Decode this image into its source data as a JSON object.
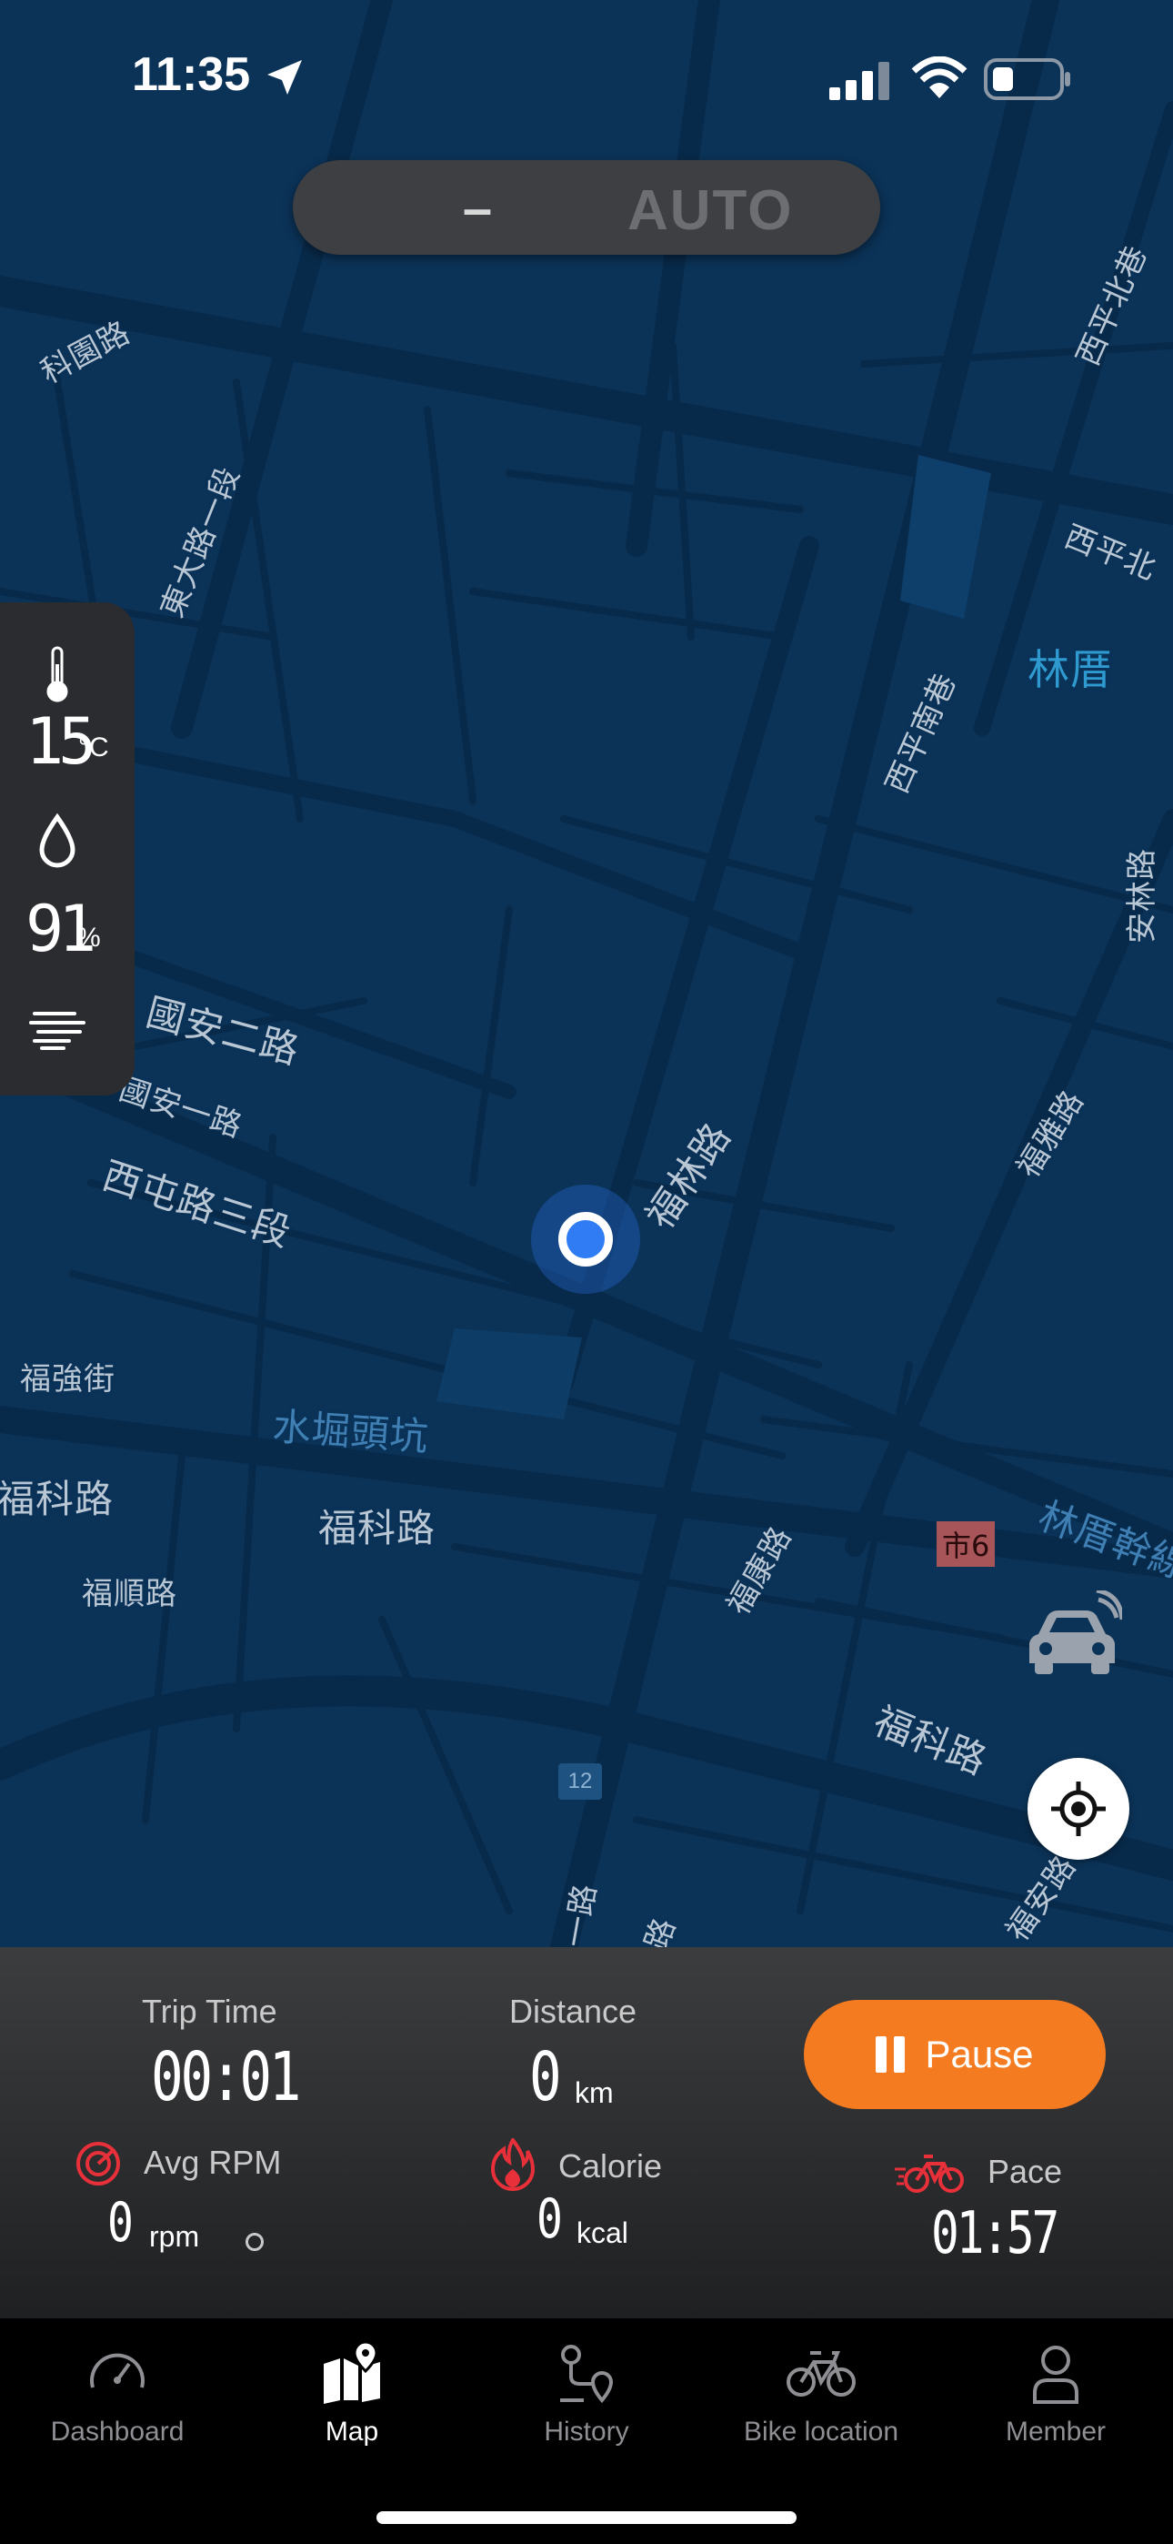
{
  "status_bar": {
    "time": "11:35"
  },
  "mode_pill": {
    "dash": "–",
    "auto_label": "AUTO"
  },
  "weather": {
    "temperature": "15",
    "temperature_unit": "°C",
    "humidity": "91",
    "humidity_unit": "%"
  },
  "map": {
    "labels": {
      "l1": "科園路",
      "l2": "東大路一段",
      "l3": "西平北巷",
      "l4": "西平北",
      "l5": "林厝",
      "l6": "西平南巷",
      "l7": "安林路",
      "l8": "國安二路",
      "l9": "國安一路",
      "l10": "西屯路三段",
      "l11": "福林路",
      "l12": "福雅路",
      "l13": "福強街",
      "l14": "水堀頭坑",
      "l15": "福科路",
      "l16": "福科路",
      "l17": "福順路",
      "l18": "福康路",
      "l19": "林厝幹線",
      "l20": "福科路",
      "l21": "福安路",
      "l22": "一路",
      "l23": "路"
    },
    "city_badge": "市6",
    "highway_badge": "12"
  },
  "stats": {
    "trip_time_label": "Trip Time",
    "trip_time_value": "00:01",
    "distance_label": "Distance",
    "distance_value": "0",
    "distance_unit": "km",
    "pause_label": "Pause",
    "avg_rpm_label": "Avg RPM",
    "avg_rpm_value": "0",
    "avg_rpm_unit": "rpm",
    "calorie_label": "Calorie",
    "calorie_value": "0",
    "calorie_unit": "kcal",
    "pace_label": "Pace",
    "pace_value": "01:57"
  },
  "tabs": [
    {
      "label": "Dashboard",
      "icon": "speedometer-icon",
      "active": false
    },
    {
      "label": "Map",
      "icon": "map-icon",
      "active": true
    },
    {
      "label": "History",
      "icon": "route-icon",
      "active": false
    },
    {
      "label": "Bike location",
      "icon": "bike-icon",
      "active": false
    },
    {
      "label": "Member",
      "icon": "person-icon",
      "active": false
    }
  ],
  "colors": {
    "map_background": "#0b3358",
    "accent_orange": "#f47b20",
    "user_dot": "#2f7cf5",
    "icon_red": "#e8303a"
  }
}
